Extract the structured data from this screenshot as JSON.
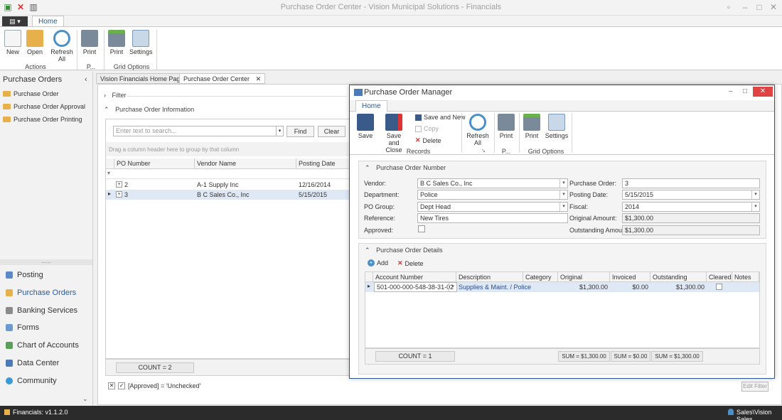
{
  "window": {
    "title": "Purchase Order Center - Vision Municipal Solutions - Financials"
  },
  "ribbon": {
    "tab_home": "Home",
    "buttons": {
      "new": "New",
      "open": "Open",
      "refresh": "Refresh All",
      "print": "Print",
      "grid_print": "Print",
      "settings": "Settings"
    },
    "groups": {
      "actions": "Actions",
      "p": "P...",
      "grid_options": "Grid Options"
    }
  },
  "sidebar": {
    "title": "Purchase Orders",
    "items": [
      "Purchase Order",
      "Purchase Order Approval",
      "Purchase Order Printing"
    ],
    "grip": "......",
    "nav": [
      "Posting",
      "Purchase Orders",
      "Banking Services",
      "Forms",
      "Chart of Accounts",
      "Data Center",
      "Community"
    ]
  },
  "doctabs": [
    "Vision Financials Home Page",
    "Purchase Order Center"
  ],
  "po_center": {
    "filter_label": "Filter",
    "info_label": "Purchase Order Information",
    "search_placeholder": "Enter text to search...",
    "find": "Find",
    "clear": "Clear",
    "group_hint": "Drag a column header here to group by that column",
    "columns": [
      "PO Number",
      "Vendor Name",
      "Posting Date"
    ],
    "rows": [
      {
        "po": "2",
        "vendor": "A-1 Supply Inc",
        "date": "12/16/2014"
      },
      {
        "po": "3",
        "vendor": "B C Sales Co., Inc",
        "date": "5/15/2015"
      }
    ],
    "count": "COUNT = 2",
    "filter_text": "[Approved] = 'Unchecked'",
    "edit_filter": "Edit Filter"
  },
  "dialog": {
    "title": "Purchase Order Manager",
    "tab": "Home",
    "buttons": {
      "save": "Save",
      "save_close": "Save and Close",
      "save_new": "Save and New",
      "copy": "Copy",
      "delete": "Delete",
      "refresh": "Refresh All",
      "print": "Print",
      "grid_print": "Print",
      "settings": "Settings"
    },
    "groups": {
      "records": "Records",
      "p": "P...",
      "grid_options": "Grid Options"
    },
    "header_section": "Purchase Order Number",
    "fields": {
      "vendor_label": "Vendor:",
      "vendor": "B C Sales Co., Inc",
      "department_label": "Department:",
      "department": "Police",
      "po_group_label": "PO Group:",
      "po_group": "Dept Head",
      "reference_label": "Reference:",
      "reference": "New Tires",
      "approved_label": "Approved:",
      "po_label": "Purchase Order:",
      "po": "3",
      "posting_date_label": "Posting Date:",
      "posting_date": "5/15/2015",
      "fiscal_label": "Fiscal:",
      "fiscal": "2014",
      "original_label": "Original Amount:",
      "original": "$1,300.00",
      "outstanding_label": "Outstanding Amount:",
      "outstanding": "$1,300.00"
    },
    "details_section": "Purchase Order Details",
    "add": "Add",
    "delete": "Delete",
    "columns": [
      "Account Number",
      "Description",
      "Category",
      "Original",
      "Invoiced",
      "Outstanding",
      "Cleared",
      "Notes"
    ],
    "row": {
      "account": "501-000-000-548-38-31-02",
      "description": "Supplies & Maint. / Police",
      "category": "",
      "original": "$1,300.00",
      "invoiced": "$0.00",
      "outstanding": "$1,300.00"
    },
    "summary": {
      "count": "COUNT = 1",
      "sum_original": "SUM = $1,300.00",
      "sum_invoiced": "SUM = $0.00",
      "sum_outstanding": "SUM = $1,300.00"
    }
  },
  "status": {
    "version": "Financials: v1.1.2.0",
    "user": "Sales\\Vision Sales"
  },
  "colors": {
    "accent": "#2b579a",
    "folder": "#e8b04a",
    "statusbar": "#2b2b2b",
    "close": "#e04343"
  }
}
